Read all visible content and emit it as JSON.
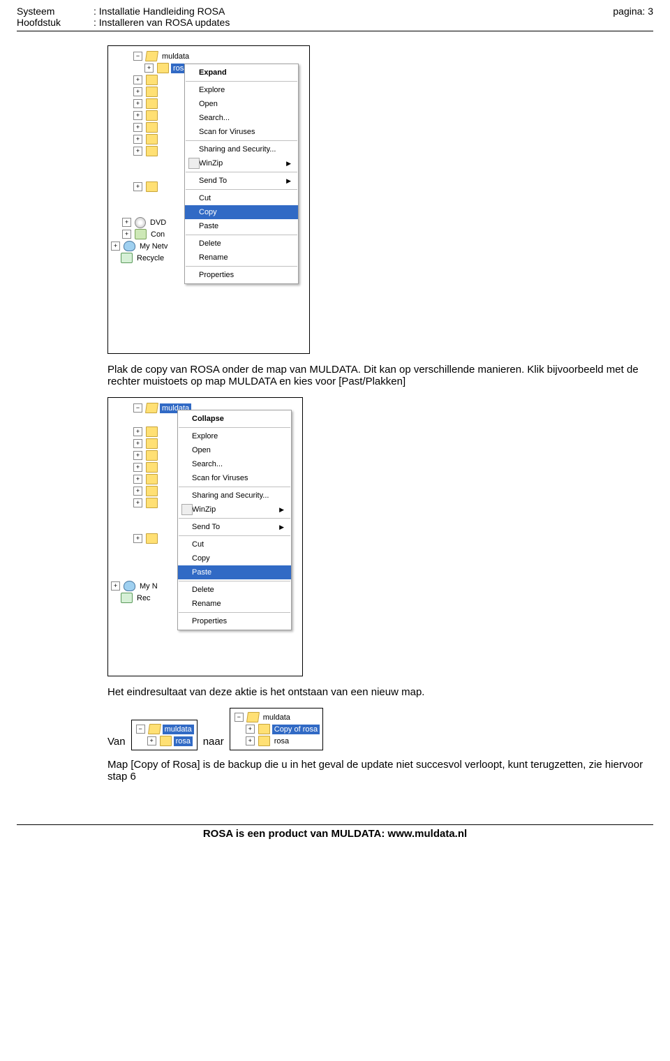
{
  "header": {
    "systeem_lbl": "Systeem",
    "hoofdstuk_lbl": "Hoofdstuk",
    "systeem_val": ": Installatie Handleiding ROSA",
    "hoofdstuk_val": ": Installeren van ROSA updates",
    "page_lbl": "pagina:  3"
  },
  "screenshot1": {
    "tree": {
      "muldata": "muldata",
      "rosa": "rosa",
      "dvd": "DVD",
      "con": "Con",
      "mynet": "My Netv",
      "recycle": "Recycle"
    },
    "menu": {
      "expand": "Expand",
      "explore": "Explore",
      "open": "Open",
      "search": "Search...",
      "scan": "Scan for Viruses",
      "sharing": "Sharing and Security...",
      "winzip": "WinZip",
      "sendto": "Send To",
      "cut": "Cut",
      "copy": "Copy",
      "paste": "Paste",
      "delete": "Delete",
      "rename": "Rename",
      "properties": "Properties"
    }
  },
  "para1": "Plak de copy van ROSA onder de map van MULDATA. Dit kan op verschillende manieren. Klik bijvoorbeeld met de rechter muistoets op map MULDATA en kies voor [Past/Plakken]",
  "screenshot2": {
    "tree": {
      "muldata": "muldata",
      "myn": "My N",
      "rec": "Rec"
    },
    "menu": {
      "collapse": "Collapse",
      "explore": "Explore",
      "open": "Open",
      "search": "Search...",
      "scan": "Scan for Viruses",
      "sharing": "Sharing and Security...",
      "winzip": "WinZip",
      "sendto": "Send To",
      "cut": "Cut",
      "copy": "Copy",
      "paste": "Paste",
      "delete": "Delete",
      "rename": "Rename",
      "properties": "Properties"
    }
  },
  "para2": "Het eindresultaat van deze aktie is het ontstaan van een nieuw map.",
  "inline": {
    "van": "Van",
    "naar": "naar",
    "mini1": {
      "muldata": "muldata",
      "rosa": "rosa"
    },
    "mini2": {
      "muldata": "muldata",
      "copyof": "Copy of rosa",
      "rosa": "rosa"
    }
  },
  "para3": "Map [Copy of Rosa] is de backup die u in het geval de update niet succesvol verloopt, kunt terugzetten, zie hiervoor stap 6",
  "footer": "ROSA is een product van MULDATA: www.muldata.nl"
}
